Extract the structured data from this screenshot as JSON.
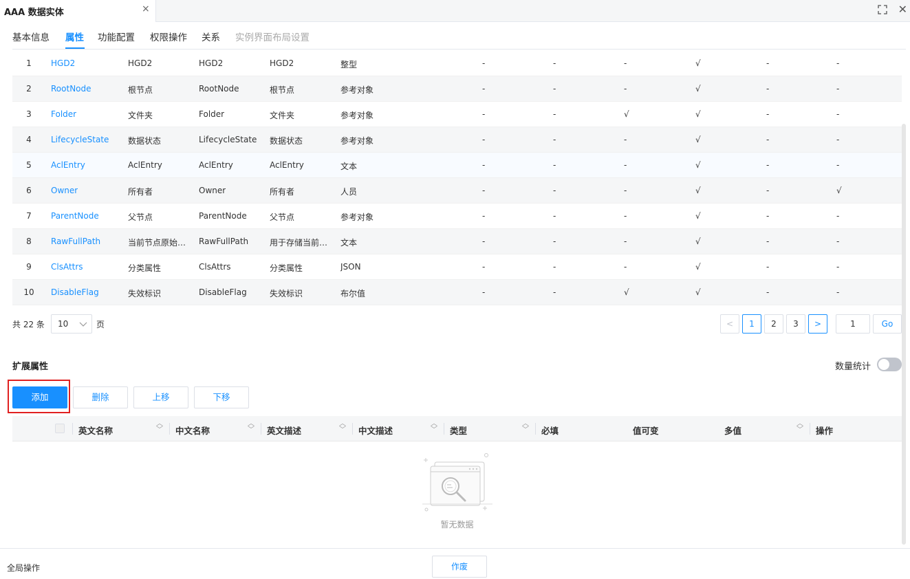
{
  "window": {
    "tab_title": "AAA 数据实体",
    "close_glyph": "×",
    "fullscreen_glyph": "⛶",
    "win_close_glyph": "✕"
  },
  "subtabs": [
    {
      "label": "基本信息",
      "state": "normal"
    },
    {
      "label": "属性",
      "state": "active"
    },
    {
      "label": "功能配置",
      "state": "normal"
    },
    {
      "label": "权限操作",
      "state": "normal"
    },
    {
      "label": "关系",
      "state": "normal"
    },
    {
      "label": "实例界面布局设置",
      "state": "disabled"
    }
  ],
  "attributes": [
    {
      "idx": "1",
      "en": "HGD2",
      "cn": "HGD2",
      "en_desc": "HGD2",
      "cn_desc": "HGD2",
      "type": "整型",
      "flags": [
        "-",
        "-",
        "-",
        "√",
        "-",
        "-"
      ]
    },
    {
      "idx": "2",
      "en": "RootNode",
      "cn": "根节点",
      "en_desc": "RootNode",
      "cn_desc": "根节点",
      "type": "参考对象",
      "flags": [
        "-",
        "-",
        "-",
        "√",
        "-",
        "-"
      ]
    },
    {
      "idx": "3",
      "en": "Folder",
      "cn": "文件夹",
      "en_desc": "Folder",
      "cn_desc": "文件夹",
      "type": "参考对象",
      "flags": [
        "-",
        "-",
        "√",
        "√",
        "-",
        "-"
      ]
    },
    {
      "idx": "4",
      "en": "LifecycleState",
      "cn": "数据状态",
      "en_desc": "LifecycleState",
      "cn_desc": "数据状态",
      "type": "参考对象",
      "flags": [
        "-",
        "-",
        "-",
        "√",
        "-",
        "-"
      ]
    },
    {
      "idx": "5",
      "en": "AclEntry",
      "cn": "AclEntry",
      "en_desc": "AclEntry",
      "cn_desc": "AclEntry",
      "type": "文本",
      "flags": [
        "-",
        "-",
        "-",
        "√",
        "-",
        "-"
      ]
    },
    {
      "idx": "6",
      "en": "Owner",
      "cn": "所有者",
      "en_desc": "Owner",
      "cn_desc": "所有者",
      "type": "人员",
      "flags": [
        "-",
        "-",
        "-",
        "√",
        "-",
        "√"
      ]
    },
    {
      "idx": "7",
      "en": "ParentNode",
      "cn": "父节点",
      "en_desc": "ParentNode",
      "cn_desc": "父节点",
      "type": "参考对象",
      "flags": [
        "-",
        "-",
        "-",
        "√",
        "-",
        "-"
      ]
    },
    {
      "idx": "8",
      "en": "RawFullPath",
      "cn": "当前节点原始…",
      "en_desc": "RawFullPath",
      "cn_desc": "用于存储当前…",
      "type": "文本",
      "flags": [
        "-",
        "-",
        "-",
        "√",
        "-",
        "-"
      ]
    },
    {
      "idx": "9",
      "en": "ClsAttrs",
      "cn": "分类属性",
      "en_desc": "ClsAttrs",
      "cn_desc": "分类属性",
      "type": "JSON",
      "flags": [
        "-",
        "-",
        "-",
        "√",
        "-",
        "-"
      ]
    },
    {
      "idx": "10",
      "en": "DisableFlag",
      "cn": "失效标识",
      "en_desc": "DisableFlag",
      "cn_desc": "失效标识",
      "type": "布尔值",
      "flags": [
        "-",
        "-",
        "√",
        "√",
        "-",
        "-"
      ]
    }
  ],
  "pagination": {
    "total_label": "共 22 条",
    "page_size": "10",
    "page_unit": "页",
    "prev_glyph": "<",
    "next_glyph": ">",
    "pages": [
      "1",
      "2",
      "3"
    ],
    "current_page": "1",
    "jump_value": "1",
    "go_label": "Go"
  },
  "extended": {
    "title": "扩展属性",
    "count_label": "数量统计",
    "count_enabled": false,
    "buttons": {
      "add": "添加",
      "delete": "删除",
      "up": "上移",
      "down": "下移"
    },
    "columns": [
      "英文名称",
      "中文名称",
      "英文描述",
      "中文描述",
      "类型",
      "必填",
      "值可变",
      "多值",
      "操作"
    ],
    "empty_text": "暂无数据"
  },
  "footer": {
    "label": "全局操作",
    "void_button": "作废"
  },
  "colors": {
    "accent": "#1890ff",
    "highlight_box": "#e02020",
    "stripe": "#f5f6f7"
  }
}
